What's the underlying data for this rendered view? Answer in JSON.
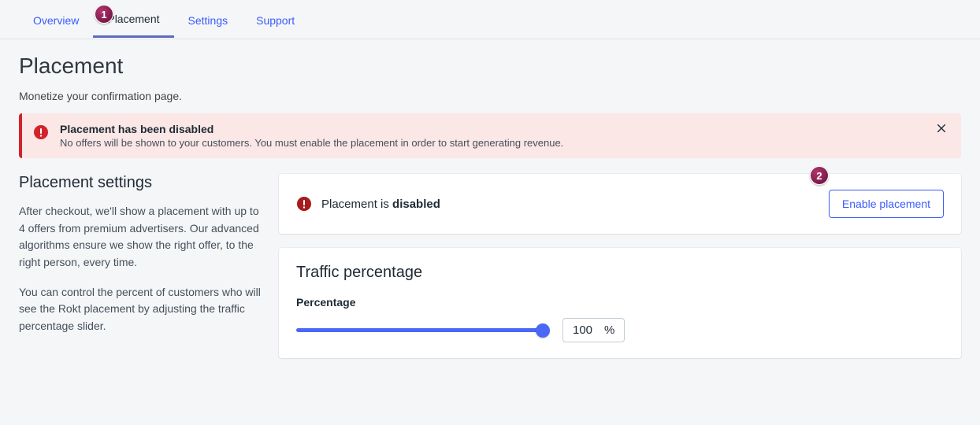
{
  "tabs": {
    "overview": "Overview",
    "placement": "Placement",
    "settings": "Settings",
    "support": "Support"
  },
  "callouts": {
    "one": "1",
    "two": "2"
  },
  "page": {
    "title": "Placement",
    "subtitle": "Monetize your confirmation page."
  },
  "alert": {
    "title": "Placement has been disabled",
    "desc": "No offers will be shown to your customers. You must enable the placement in order to start generating revenue."
  },
  "settings_section": {
    "title": "Placement settings",
    "desc1": "After checkout, we'll show a placement with up to 4 offers from premium advertisers. Our advanced algorithms ensure we show the right offer, to the right person, every time.",
    "desc2": "You can control the percent of customers who will see the Rokt placement by adjusting the traffic percentage slider."
  },
  "status_card": {
    "prefix": "Placement is ",
    "state": "disabled",
    "button": "Enable placement"
  },
  "traffic": {
    "title": "Traffic percentage",
    "label": "Percentage",
    "value": "100",
    "unit": "%"
  }
}
